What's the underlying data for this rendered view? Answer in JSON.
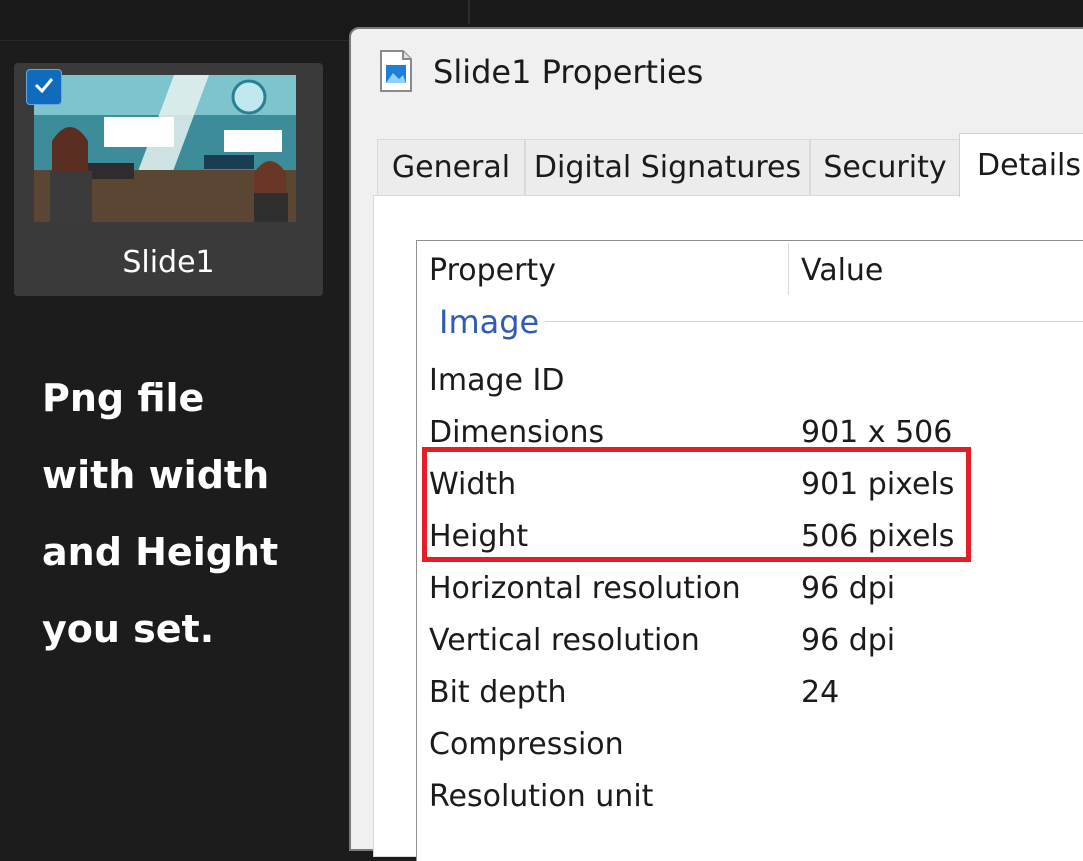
{
  "file_tile": {
    "name": "Slide1",
    "selected": true,
    "check_icon": "checkmark-icon"
  },
  "caption": {
    "lines": [
      "Png file",
      "with width",
      "and Height",
      "you set."
    ]
  },
  "dialog": {
    "title": "Slide1 Properties",
    "icon": "image-file-icon",
    "tabs": [
      "General",
      "Digital Signatures",
      "Security",
      "Details"
    ],
    "active_tab": "Details",
    "columns": {
      "property": "Property",
      "value": "Value"
    },
    "group": "Image",
    "rows": [
      {
        "property": "Image ID",
        "value": ""
      },
      {
        "property": "Dimensions",
        "value": "901 x 506"
      },
      {
        "property": "Width",
        "value": "901 pixels"
      },
      {
        "property": "Height",
        "value": "506 pixels"
      },
      {
        "property": "Horizontal resolution",
        "value": "96 dpi"
      },
      {
        "property": "Vertical resolution",
        "value": "96 dpi"
      },
      {
        "property": "Bit depth",
        "value": "24"
      },
      {
        "property": "Compression",
        "value": ""
      },
      {
        "property": "Resolution unit",
        "value": ""
      }
    ]
  },
  "colors": {
    "highlight_border": "#e31e24",
    "group_label": "#2f5bb7",
    "check_accent": "#0f6cbd"
  }
}
